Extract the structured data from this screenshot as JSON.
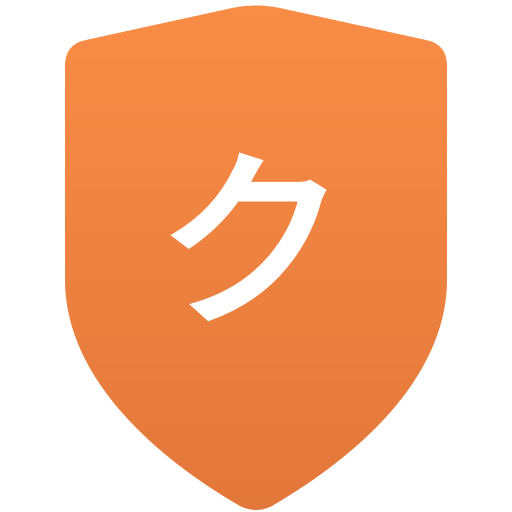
{
  "badge": {
    "glyph": "ク",
    "gradient_top": "#F98D46",
    "gradient_bottom": "#E2773A",
    "glyph_color": "#FFFFFF",
    "icon": "shield-icon"
  }
}
